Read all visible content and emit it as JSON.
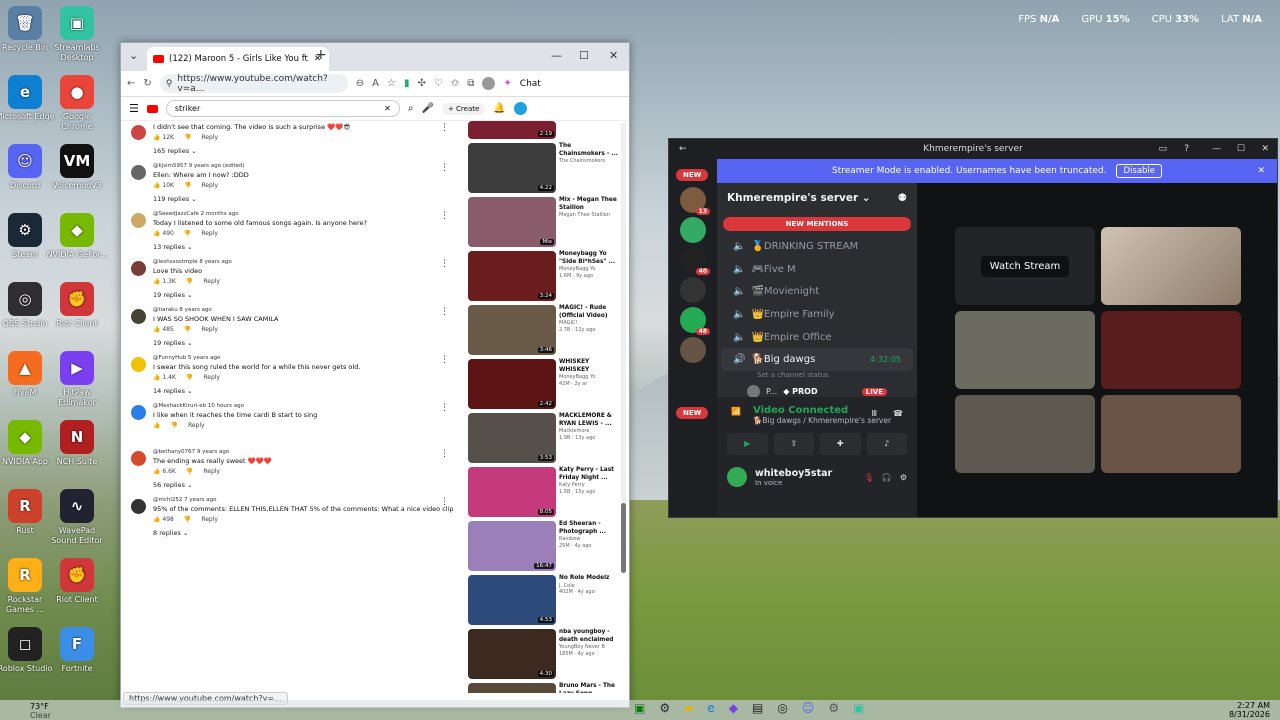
{
  "hud": {
    "fps_label": "FPS",
    "fps": "N/A",
    "gpu_label": "GPU",
    "gpu": "15%",
    "cpu_label": "CPU",
    "cpu": "33%",
    "lat_label": "LAT",
    "lat": "N/A"
  },
  "desktop": [
    {
      "label": "Recycle Bin",
      "color": "#5a7fa5",
      "glyph": "🗑"
    },
    {
      "label": "Streamlabs Desktop",
      "color": "#31c3a2",
      "glyph": "▣"
    },
    {
      "label": "Microsoft Edge",
      "color": "#0f7fd1",
      "glyph": "e"
    },
    {
      "label": "Google Chrome",
      "color": "#e9453a",
      "glyph": "●"
    },
    {
      "label": "Discord",
      "color": "#5865f2",
      "glyph": "☺"
    },
    {
      "label": "VoicemodV3",
      "color": "#111",
      "glyph": "VM"
    },
    {
      "label": "Steam",
      "color": "#1b2838",
      "glyph": "⚙"
    },
    {
      "label": "NVIDIA GeFor...",
      "color": "#76b900",
      "glyph": "◆"
    },
    {
      "label": "OBS Studio",
      "color": "#302e31",
      "glyph": "◎"
    },
    {
      "label": "Riot Client",
      "color": "#d13639",
      "glyph": "✊"
    },
    {
      "label": "FiveM",
      "color": "#f56b1f",
      "glyph": "▲"
    },
    {
      "label": "HitPaw Edimakor",
      "color": "#7b3ff2",
      "glyph": "▶"
    },
    {
      "label": "NVIDIA App",
      "color": "#76b900",
      "glyph": "◆"
    },
    {
      "label": "NCH Suite",
      "color": "#b02020",
      "glyph": "N"
    },
    {
      "label": "Rust",
      "color": "#cd412b",
      "glyph": "R"
    },
    {
      "label": "WavePad Sound Editor",
      "color": "#223",
      "glyph": "∿"
    },
    {
      "label": "Rockstar Games ...",
      "color": "#fcaf17",
      "glyph": "R"
    },
    {
      "label": "Riot Client",
      "color": "#d13639",
      "glyph": "✊"
    },
    {
      "label": "Roblox Studio",
      "color": "#222",
      "glyph": "◻"
    },
    {
      "label": "Fortnite",
      "color": "#3a8ee6",
      "glyph": "F"
    }
  ],
  "browser": {
    "tab_title": "(122) Maroon 5 - Girls Like You ft.",
    "url": "https://www.youtube.com/watch?v=a...",
    "chat_label": "Chat",
    "search_value": "striker",
    "create_label": "Create",
    "status_url": "https://www.youtube.com/watch?v=...",
    "comments": [
      {
        "author": "",
        "text": "I didn't see that coming. The video is such a surprise ❤️❤️😎",
        "likes": "12K",
        "reply": "Reply",
        "replies": "165 replies",
        "color": "#c44"
      },
      {
        "author": "@kjsim5957 9 years ago (edited)",
        "text": "Ellen: Where am I now? :DDD",
        "likes": "10K",
        "reply": "Reply",
        "replies": "119 replies",
        "color": "#666"
      },
      {
        "author": "@SeeedJazzCafe 2 months ago",
        "text": "Today I listened to some old famous songs again. Is anyone here?",
        "likes": "490",
        "reply": "Reply",
        "replies": "13 replies",
        "color": "#ccaa66"
      },
      {
        "author": "@leshssostmple 8 years ago",
        "text": "Love this video",
        "likes": "1.3K",
        "reply": "Reply",
        "replies": "19 replies",
        "color": "#7a3b3b"
      },
      {
        "author": "@tiaraku 8 years ago",
        "text": "I WAS SO SHOOK WHEN I SAW CAMILA",
        "likes": "485",
        "reply": "Reply",
        "replies": "19 replies",
        "color": "#443"
      },
      {
        "author": "@FunnyHub 5 years ago",
        "text": "I swear this song ruled the world for a while this never gets old.",
        "likes": "1.4K",
        "reply": "Reply",
        "replies": "14 replies",
        "color": "#f2c200"
      },
      {
        "author": "@MeshackKiruri-eb 10 hours ago",
        "text": "I like when it reaches the time cardi B start to sing",
        "likes": "",
        "reply": "Reply",
        "replies": "",
        "color": "#2b7de9"
      },
      {
        "author": "@bethany0767 9 years ago",
        "text": "The ending was really sweet ❤️❤️❤️",
        "likes": "6.6K",
        "reply": "Reply",
        "replies": "56 replies",
        "color": "#d8492c"
      },
      {
        "author": "@mchl252 7 years ago",
        "text": "95% of the comments: ELLEN THIS,ELLEN THAT 5% of the comments: What a nice video clip",
        "likes": "498",
        "reply": "Reply",
        "replies": "8 replies",
        "color": "#333"
      }
    ],
    "related": [
      {
        "title": "",
        "channel": "",
        "meta": "",
        "dur": "2:19",
        "color": "#7b2030"
      },
      {
        "title": "The Chainsmokers - ...",
        "channel": "The Chainsmokers",
        "meta": "",
        "dur": "4:22",
        "color": "#3d3d3d"
      },
      {
        "title": "Mix - Megan Thee Stallion",
        "channel": "Megan Thee Stallion",
        "meta": "",
        "dur": "Mix",
        "color": "#8a5c6b"
      },
      {
        "title": "Moneybagg Yo \"Side Bi*hSes\" ...",
        "channel": "MoneyBagg Yo",
        "meta": "1.6M · 9y ago",
        "dur": "3:24",
        "color": "#6b1c1c"
      },
      {
        "title": "MAGIC! - Rude (Official Video)",
        "channel": "MAGIC!",
        "meta": "2.7B · 12y ago",
        "dur": "3:46",
        "color": "#6a5a48"
      },
      {
        "title": "WHISKEY WHISKEY",
        "channel": "MoneyBagg Yo",
        "meta": "42M · 2y ar",
        "dur": "2:42",
        "color": "#5c1414"
      },
      {
        "title": "MACKLEMORE & RYAN LEWIS - ...",
        "channel": "Macklemore",
        "meta": "1.9B · 13y ago",
        "dur": "3:53",
        "color": "#55504a"
      },
      {
        "title": "Katy Perry - Last Friday Night ...",
        "channel": "Katy Perry",
        "meta": "1.5B · 15y ago",
        "dur": "8:05",
        "color": "#c43a7a"
      },
      {
        "title": "Ed Sheeran - Photograph ...",
        "channel": "Rainbow",
        "meta": "25M · 4y ago",
        "dur": "16:47",
        "color": "#9b7fb8"
      },
      {
        "title": "No Role Modelz",
        "channel": "J. Cole",
        "meta": "402M · 4y ago",
        "dur": "4:53",
        "color": "#2c4a7a"
      },
      {
        "title": "nba youngboy - death enclaimed",
        "channel": "YoungBoy Never B",
        "meta": "185M · 4y ago",
        "dur": "4:30",
        "color": "#3c2a20"
      },
      {
        "title": "Bruno Mars - The Lazy Song (Offici...",
        "channel": "Bruno Mars",
        "meta": "",
        "dur": "",
        "color": "#5a4a3a"
      }
    ]
  },
  "discord": {
    "title": "Khmerempire's server",
    "streamer_msg": "Streamer Mode is enabled. Usernames have been truncated.",
    "disable": "Disable",
    "server_name": "Khmerempire's server",
    "new_mentions": "NEW MENTIONS",
    "new": "NEW",
    "badges": [
      "13",
      "40",
      "48"
    ],
    "channels": [
      "🏅DRINKING STREAM",
      "🎮Five M",
      "🎬Movienight",
      "👑Empire Family",
      "👑Empire Office"
    ],
    "active_channel": "🐕Big dawgs",
    "active_time": "4:32:05",
    "channel_status": "Set a channel status",
    "member": "P...",
    "member_tag": "PROD",
    "live": "LIVE",
    "vc_title": "Video Connected",
    "vc_sub": "🐕Big dawgs / Khmerempire's server",
    "username": "whiteboy5star",
    "userstatus": "In voice",
    "watch_stream": "Watch Stream"
  },
  "taskbar": {
    "weather_temp": "73°F",
    "weather": "Clear",
    "time": "2:27 AM",
    "date": "8/31/2026"
  }
}
